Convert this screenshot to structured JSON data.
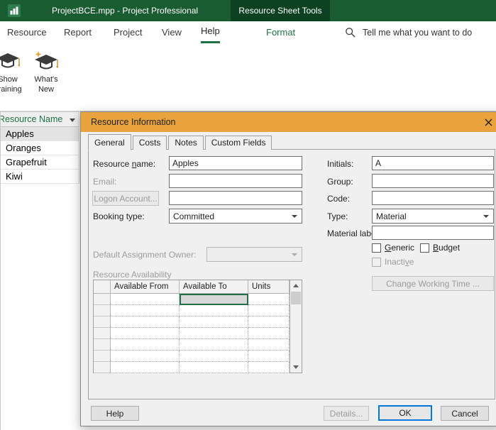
{
  "colors": {
    "titlebar_green": "#185C2F",
    "contextual_tab_green": "#0C4121",
    "accent_green": "#217346",
    "dialog_titlebar_orange": "#E8A33C",
    "default_button_border_blue": "#0078D7",
    "selected_cell_border_green": "#1E7145"
  },
  "titlebar": {
    "title": "ProjectBCE.mpp - Project Professional",
    "contextual_group": "Resource Sheet Tools"
  },
  "ribbon": {
    "tabs": [
      "Resource",
      "Report",
      "Project",
      "View",
      "Help"
    ],
    "active_tab": "Help",
    "format_tab": "Format",
    "tell_me": "Tell me what you want to do",
    "buttons": [
      {
        "line1": "Show",
        "line2": "Training"
      },
      {
        "line1": "What's",
        "line2": "New"
      }
    ]
  },
  "sheet": {
    "header": "Resource Name",
    "rows": [
      "Apples",
      "Oranges",
      "Grapefruit",
      "Kiwi"
    ],
    "selected_row": "Apples"
  },
  "dialog": {
    "title": "Resource Information",
    "tabs": [
      "General",
      "Costs",
      "Notes",
      "Custom Fields"
    ],
    "active_tab": "General",
    "general": {
      "resource_name": {
        "pre": "Resource ",
        "key": "n",
        "post": "ame:",
        "value": "Apples"
      },
      "email_label": "Email:",
      "email_value": "",
      "logon_account": "Logon Account...",
      "booking_type_label": "Booking type:",
      "booking_type_value": "Committed",
      "initials_label": "Initials:",
      "initials_value": "A",
      "group_label": "Group:",
      "group_value": "",
      "code_label": "Code:",
      "code_value": "",
      "type_label": "Type:",
      "type_value": "Material",
      "material_label": "Material label:",
      "material_value": "",
      "generic": {
        "pre": "",
        "key": "G",
        "post": "eneric"
      },
      "budget": {
        "pre": "",
        "key": "B",
        "post": "udget"
      },
      "inactive": {
        "pre": "Inacti",
        "key": "v",
        "post": "e"
      },
      "default_assignment_owner_label": "Default Assignment Owner:",
      "default_assignment_owner_value": "",
      "resource_availability_label": "Resource Availability",
      "grid": {
        "columns": [
          "Available From",
          "Available To",
          "Units"
        ],
        "empty_rows": 7,
        "selected_cell": {
          "row": 0,
          "column": "Available To"
        }
      },
      "change_working_time": "Change Working Time ..."
    },
    "buttons": {
      "help": "Help",
      "details": "Details...",
      "ok": "OK",
      "cancel": "Cancel"
    }
  }
}
